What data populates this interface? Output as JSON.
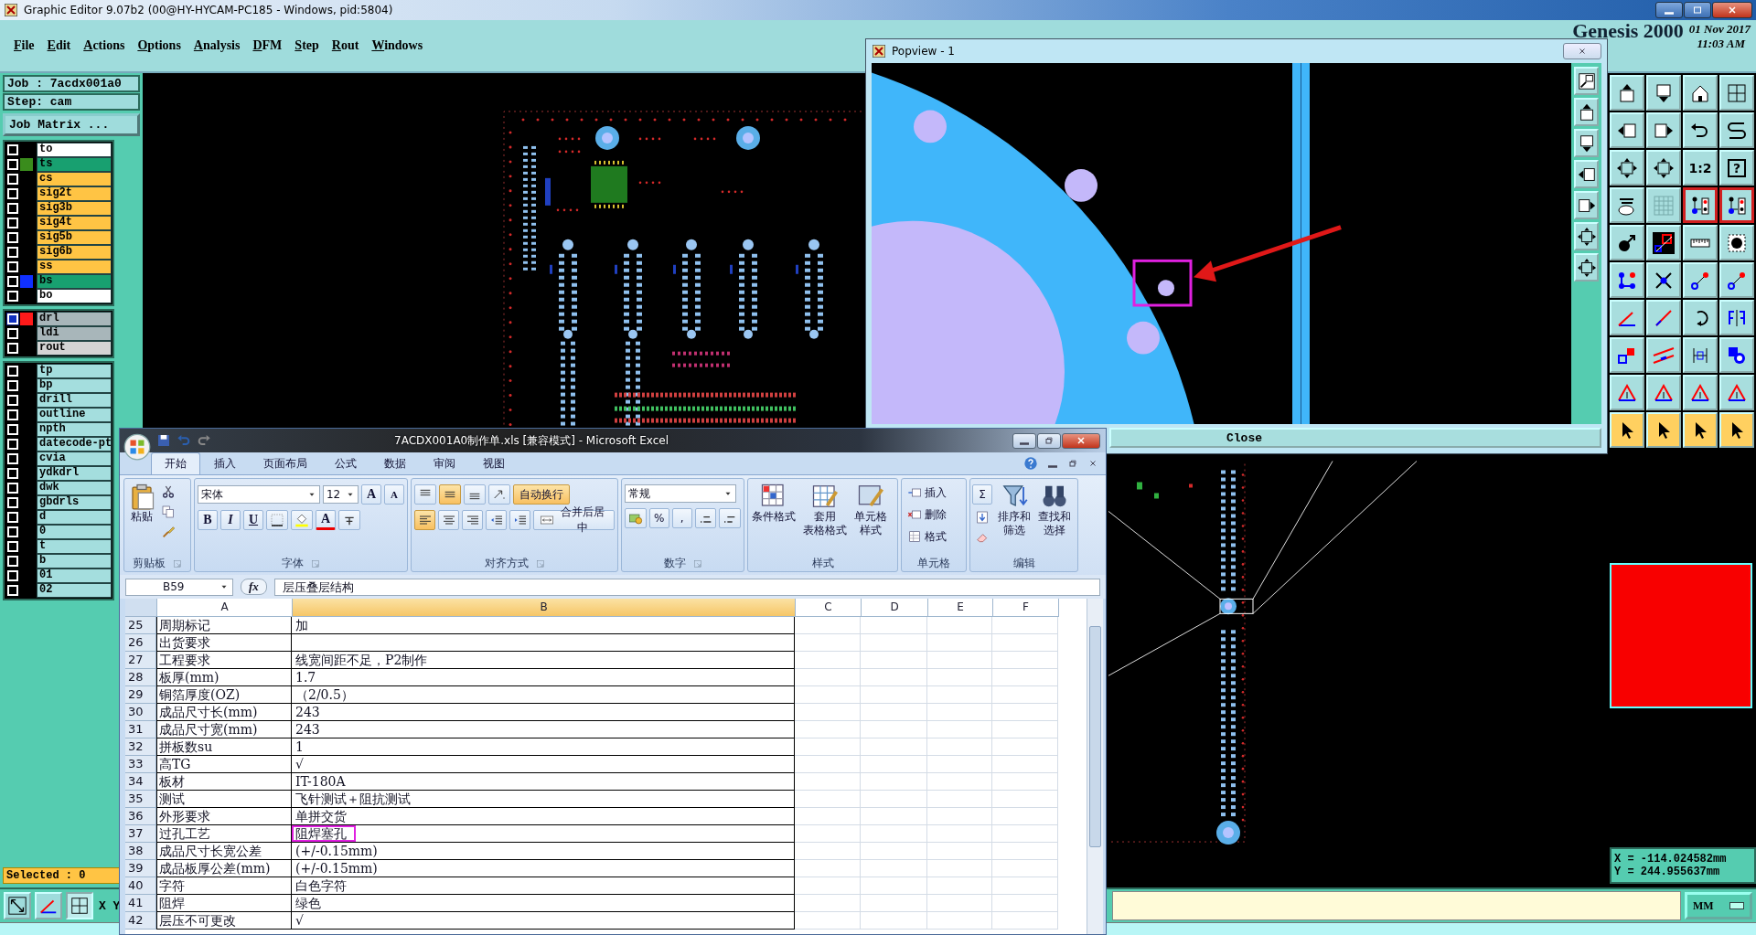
{
  "window": {
    "title": "Graphic Editor 9.07b2 (00@HY-HYCAM-PC185 - Windows, pid:5804)"
  },
  "menu": [
    "File",
    "Edit",
    "Actions",
    "Options",
    "Analysis",
    "DFM",
    "Step",
    "Rout",
    "Windows"
  ],
  "header": {
    "product": "Genesis 2000",
    "date": "01 Nov 2017",
    "time": "11:03 AM"
  },
  "job": {
    "job": "Job : 7acdx001a0",
    "step": "Step: cam",
    "matrix_button": "Job Matrix ..."
  },
  "layer_groups": [
    [
      {
        "name": "to",
        "kind": "silk_screen",
        "checked": false
      },
      {
        "name": "ts",
        "kind": "solder_mask",
        "color": "#3a8c1c",
        "checked": false
      },
      {
        "name": "cs",
        "kind": "signal",
        "checked": false
      },
      {
        "name": "sig2t",
        "kind": "signal",
        "checked": false
      },
      {
        "name": "sig3b",
        "kind": "signal",
        "checked": false
      },
      {
        "name": "sig4t",
        "kind": "signal",
        "checked": false
      },
      {
        "name": "sig5b",
        "kind": "signal",
        "checked": false
      },
      {
        "name": "sig6b",
        "kind": "signal",
        "checked": false
      },
      {
        "name": "ss",
        "kind": "signal",
        "checked": false
      },
      {
        "name": "bs",
        "kind": "solder_mask",
        "color": "#1030ff",
        "checked": false
      },
      {
        "name": "bo",
        "kind": "silk_screen",
        "checked": false
      }
    ],
    [
      {
        "name": "drl",
        "kind": "drill",
        "color": "#ff1a1a",
        "checked": true
      },
      {
        "name": "ldi",
        "kind": "drill",
        "checked": false
      },
      {
        "name": "rout",
        "kind": "rout",
        "checked": false
      }
    ],
    [
      {
        "name": "tp",
        "kind": "misc",
        "checked": false
      },
      {
        "name": "bp",
        "kind": "misc",
        "checked": false
      },
      {
        "name": "drill",
        "kind": "misc",
        "checked": false
      },
      {
        "name": "outline",
        "kind": "misc",
        "checked": false
      },
      {
        "name": "npth",
        "kind": "misc",
        "checked": false
      },
      {
        "name": "datecode-pt",
        "kind": "misc",
        "checked": false
      },
      {
        "name": "cvia",
        "kind": "misc",
        "checked": false
      },
      {
        "name": "ydkdrl",
        "kind": "misc",
        "checked": false
      },
      {
        "name": "dwk",
        "kind": "misc",
        "checked": false
      },
      {
        "name": "gbdrls",
        "kind": "misc",
        "checked": false
      },
      {
        "name": "d",
        "kind": "misc",
        "checked": false
      },
      {
        "name": "0",
        "kind": "misc",
        "checked": false
      },
      {
        "name": "t",
        "kind": "misc",
        "checked": false
      },
      {
        "name": "b",
        "kind": "misc",
        "checked": false
      },
      {
        "name": "01",
        "kind": "misc",
        "checked": false
      },
      {
        "name": "02",
        "kind": "misc",
        "checked": false
      }
    ]
  ],
  "selected": "Selected : 0",
  "coord_label": "X Y",
  "tool_palette": {
    "ratio_label": "1:2",
    "help_label": "?"
  },
  "coordinates": [
    "X = -114.024582mm",
    "Y = 244.955637mm"
  ],
  "units": "MM",
  "popview": {
    "title": "Popview - 1",
    "close_button": "Close"
  },
  "excel": {
    "title": "7ACDX001A0制作单.xls  [兼容模式] - Microsoft Excel",
    "tabs": [
      {
        "label": "开始",
        "selected": true
      },
      {
        "label": "插入",
        "selected": false
      },
      {
        "label": "页面布局",
        "selected": false
      },
      {
        "label": "公式",
        "selected": false
      },
      {
        "label": "数据",
        "selected": false
      },
      {
        "label": "审阅",
        "selected": false
      },
      {
        "label": "视图",
        "selected": false
      }
    ],
    "clipboard": {
      "paste": "粘贴",
      "label": "剪贴板"
    },
    "font": {
      "name": "宋体",
      "size": "12",
      "grow": "A",
      "shrink": "A",
      "bold": "B",
      "italic": "I",
      "underline": "U",
      "color_button": "A",
      "label": "字体"
    },
    "alignment": {
      "vertical_buttons": [
        {
          "selected": false
        },
        {
          "selected": true
        },
        {
          "selected": false
        }
      ],
      "horizontal_buttons": [
        {
          "selected": true
        },
        {
          "selected": false
        },
        {
          "selected": false
        }
      ],
      "wrap": "自动换行",
      "wrap_on": true,
      "merge": "合并后居中",
      "label": "对齐方式"
    },
    "number": {
      "format": "常规",
      "percent": "%",
      "comma": ",",
      "label": "数字"
    },
    "styles": {
      "buttons": [
        [
          "条件格式"
        ],
        [
          "套用",
          "表格格式"
        ],
        [
          "单元格",
          "样式"
        ]
      ],
      "label": "样式"
    },
    "cells": {
      "buttons": [
        "插入",
        "删除",
        "格式"
      ],
      "label": "单元格"
    },
    "editing": {
      "sum": "Σ",
      "buttons": [
        [
          "排序和",
          "筛选"
        ],
        [
          "查找和",
          "选择"
        ]
      ],
      "label": "编辑"
    },
    "name_box": "B59",
    "function_label": "fx",
    "formula": "层压叠层结构",
    "columns": [
      {
        "label": "A",
        "selected": false
      },
      {
        "label": "B",
        "selected": true
      },
      {
        "label": "C",
        "selected": false
      },
      {
        "label": "D",
        "selected": false
      },
      {
        "label": "E",
        "selected": false
      },
      {
        "label": "F",
        "selected": false
      }
    ],
    "rows": [
      {
        "number": "25",
        "a": "周期标记",
        "b": "加",
        "highlighted": false
      },
      {
        "number": "26",
        "a": "出货要求",
        "highlighted": false
      },
      {
        "number": "27",
        "a": "工程要求",
        "b": "线宽间距不足，P2制作",
        "highlighted": false
      },
      {
        "number": "28",
        "a": "板厚(mm)",
        "b": "1.7",
        "highlighted": false
      },
      {
        "number": "29",
        "a": "铜箔厚度(OZ)",
        "b": "（2/0.5）",
        "highlighted": false
      },
      {
        "number": "30",
        "a": "成品尺寸长(mm)",
        "b": "243",
        "highlighted": false
      },
      {
        "number": "31",
        "a": "成品尺寸宽(mm)",
        "b": "243",
        "highlighted": false
      },
      {
        "number": "32",
        "a": "拼板数su",
        "b": "1",
        "highlighted": false
      },
      {
        "number": "33",
        "a": "高TG",
        "b": "√",
        "highlighted": false
      },
      {
        "number": "34",
        "a": "板材",
        "b": "IT-180A",
        "highlighted": false
      },
      {
        "number": "35",
        "a": "测试",
        "b": "飞针测试＋阻抗测试",
        "highlighted": false
      },
      {
        "number": "36",
        "a": "外形要求",
        "b": "单拼交货",
        "highlighted": false
      },
      {
        "number": "37",
        "a": "过孔工艺",
        "b": "阻焊塞孔",
        "highlighted": true
      },
      {
        "number": "38",
        "a": "成品尺寸长宽公差",
        "b": "(+/-0.15mm)",
        "highlighted": false
      },
      {
        "number": "39",
        "a": "成品板厚公差(mm)",
        "b": "(+/-0.15mm)",
        "highlighted": false
      },
      {
        "number": "40",
        "a": "字符",
        "b": "白色字符",
        "highlighted": false
      },
      {
        "number": "41",
        "a": "阻焊",
        "b": "绿色",
        "highlighted": false
      },
      {
        "number": "42",
        "a": "层压不可更改",
        "b": "√",
        "highlighted": false
      }
    ]
  }
}
